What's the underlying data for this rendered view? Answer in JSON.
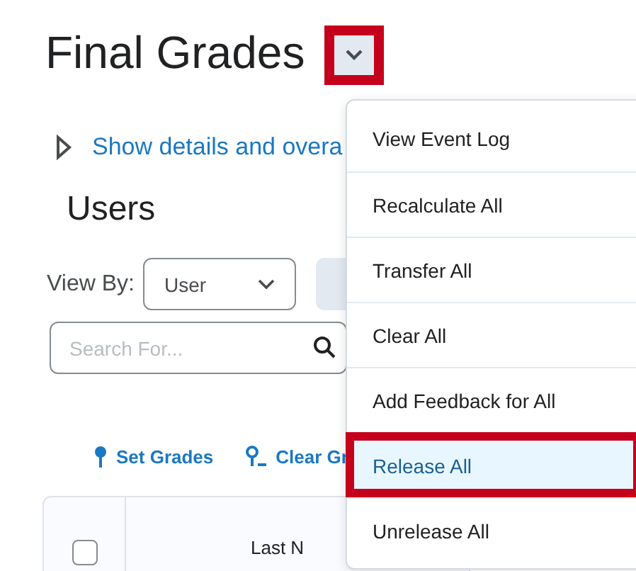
{
  "page_title": "Final Grades",
  "title_menu_button": {
    "highlighted": true
  },
  "details_link": "Show details and overa",
  "section_title": "Users",
  "view_by": {
    "label": "View By:",
    "value": "User"
  },
  "search": {
    "placeholder": "Search For..."
  },
  "actions": [
    {
      "label": "Set Grades",
      "kind": "set"
    },
    {
      "label": "Clear Gr",
      "kind": "clear"
    }
  ],
  "table": {
    "header_checkbox": {
      "checked": false
    },
    "column_2": "Last N"
  },
  "menu": [
    {
      "label": "View Event Log",
      "selected": false
    },
    {
      "label": "Recalculate All",
      "selected": false
    },
    {
      "label": "Transfer All",
      "selected": false
    },
    {
      "label": "Clear All",
      "selected": false
    },
    {
      "label": "Add Feedback for All",
      "selected": false
    },
    {
      "label": "Release All",
      "selected": true
    },
    {
      "label": "Unrelease All",
      "selected": false
    }
  ]
}
